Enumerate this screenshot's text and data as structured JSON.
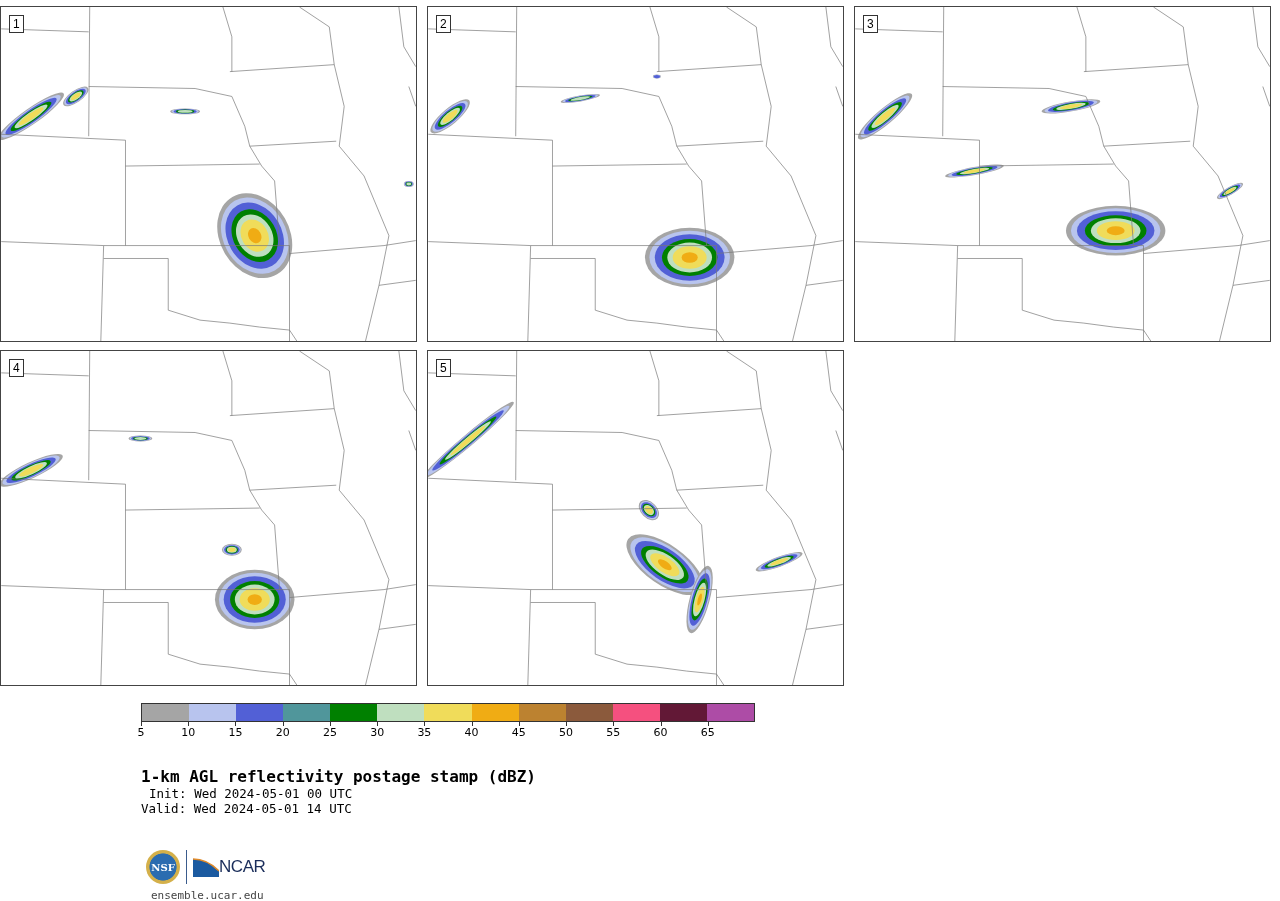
{
  "panels": [
    {
      "label": "1"
    },
    {
      "label": "2"
    },
    {
      "label": "3"
    },
    {
      "label": "4"
    },
    {
      "label": "5"
    }
  ],
  "colorbar": {
    "segments": [
      {
        "color": "#a5a5a5"
      },
      {
        "color": "#b8c4ee"
      },
      {
        "color": "#5260d6"
      },
      {
        "color": "#50969b"
      },
      {
        "color": "#008000"
      },
      {
        "color": "#bfdfbf"
      },
      {
        "color": "#f0dc5a"
      },
      {
        "color": "#f0ac14"
      },
      {
        "color": "#bc8230"
      },
      {
        "color": "#8b5a3c"
      },
      {
        "color": "#f5507f"
      },
      {
        "color": "#621836"
      },
      {
        "color": "#ad4ca6"
      }
    ],
    "ticks": [
      "5",
      "10",
      "15",
      "20",
      "25",
      "30",
      "35",
      "40",
      "45",
      "50",
      "55",
      "60",
      "65"
    ]
  },
  "title": "1-km AGL reflectivity postage stamp (dBZ)",
  "init": "Init: Wed 2024-05-01 00 UTC",
  "valid": "Valid: Wed 2024-05-01 14 UTC",
  "logo": {
    "nsf": "NSF",
    "ncar": "NCAR"
  },
  "url": "ensemble.ucar.edu"
}
